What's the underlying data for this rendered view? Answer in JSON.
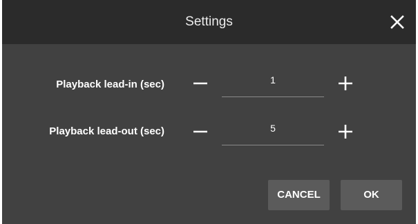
{
  "dialog": {
    "title": "Settings",
    "close_icon": "close-icon"
  },
  "settings": [
    {
      "label": "Playback lead-in (sec)",
      "value": "1",
      "decrement_icon": "minus-icon",
      "increment_icon": "plus-icon"
    },
    {
      "label": "Playback lead-out (sec)",
      "value": "5",
      "decrement_icon": "minus-icon",
      "increment_icon": "plus-icon"
    }
  ],
  "footer": {
    "cancel_label": "CANCEL",
    "ok_label": "OK"
  },
  "colors": {
    "titlebar_bg": "#2b2b2b",
    "dialog_bg": "#414141",
    "button_bg": "#5b5b5b",
    "text": "#ffffff"
  }
}
